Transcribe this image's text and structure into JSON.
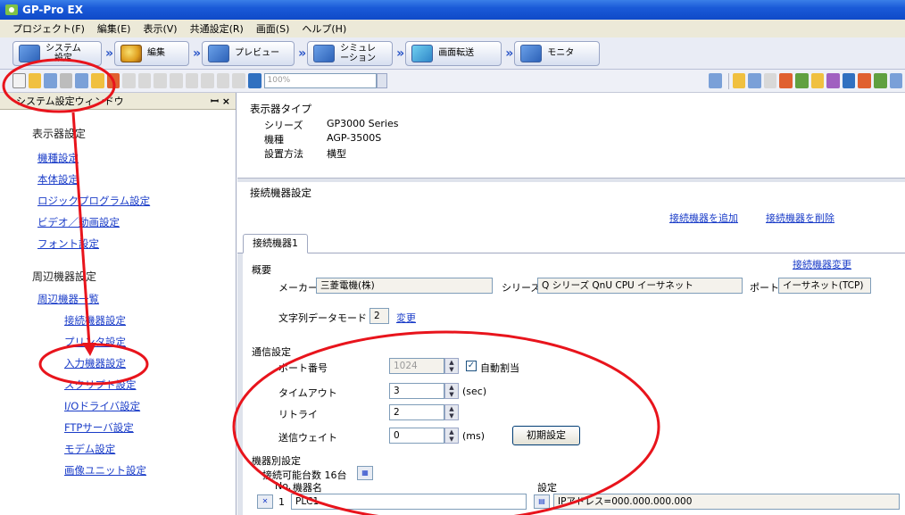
{
  "app": {
    "title": "GP-Pro EX"
  },
  "menu": [
    "プロジェクト(F)",
    "編集(E)",
    "表示(V)",
    "共通設定(R)",
    "画面(S)",
    "ヘルプ(H)"
  ],
  "workflow": {
    "system": "システム\n設定",
    "edit": "編集",
    "preview": "プレビュー",
    "simulation": "シミュレ\nーション",
    "transfer": "画面転送",
    "monitor": "モニタ"
  },
  "toolbar": {
    "zoom": "100%"
  },
  "left_panel": {
    "title": "システム設定ウィンドウ",
    "controls": "ꟷ ×",
    "display_section": "表示器設定",
    "display_items": [
      "機種設定",
      "本体設定",
      "ロジックプログラム設定",
      "ビデオ／動画設定",
      "フォント設定"
    ],
    "peripheral_section": "周辺機器設定",
    "peripheral_items": [
      "周辺機器一覧",
      "接続機器設定",
      "プリンタ設定",
      "入力機器設定",
      "スクリプト設定",
      "I/Oドライバ設定",
      "FTPサーバ設定",
      "モデム設定",
      "画像ユニット設定"
    ]
  },
  "device": {
    "heading": "表示器タイプ",
    "series_label": "シリーズ",
    "series_value": "GP3000 Series",
    "model_label": "機種",
    "model_value": "AGP-3500S",
    "install_label": "設置方法",
    "install_value": "横型"
  },
  "connection": {
    "heading": "接続機器設定",
    "add_link": "接続機器を追加",
    "delete_link": "接続機器を削除",
    "tab": "接続機器1",
    "summary_label": "概要",
    "change_link": "接続機器変更",
    "maker_label": "メーカー",
    "maker_value": "三菱電機(株)",
    "series_label": "シリーズ",
    "series_value": "Q シリーズ QnU CPU イーサネット",
    "port_label": "ポート",
    "port_value": "イーサネット(TCP)",
    "string_mode_label": "文字列データモード",
    "string_mode_value": "2",
    "string_mode_change": "変更",
    "comm_heading": "通信設定",
    "port_no_label": "ポート番号",
    "port_no_value": "1024",
    "auto_assign_label": "自動割当",
    "timeout_label": "タイムアウト",
    "timeout_value": "3",
    "timeout_unit": "(sec)",
    "retry_label": "リトライ",
    "retry_value": "2",
    "send_wait_label": "送信ウェイト",
    "send_wait_value": "0",
    "send_wait_unit": "(ms)",
    "init_button": "初期設定",
    "device_heading": "機器別設定",
    "count_label": "接続可能台数 16台",
    "col_no": "No.",
    "col_name": "機器名",
    "col_settings": "設定",
    "row_no": "1",
    "row_name": "PLC1",
    "row_settings": "IPアドレス=000.000.000.000"
  },
  "annotation_color": "#e8141c"
}
